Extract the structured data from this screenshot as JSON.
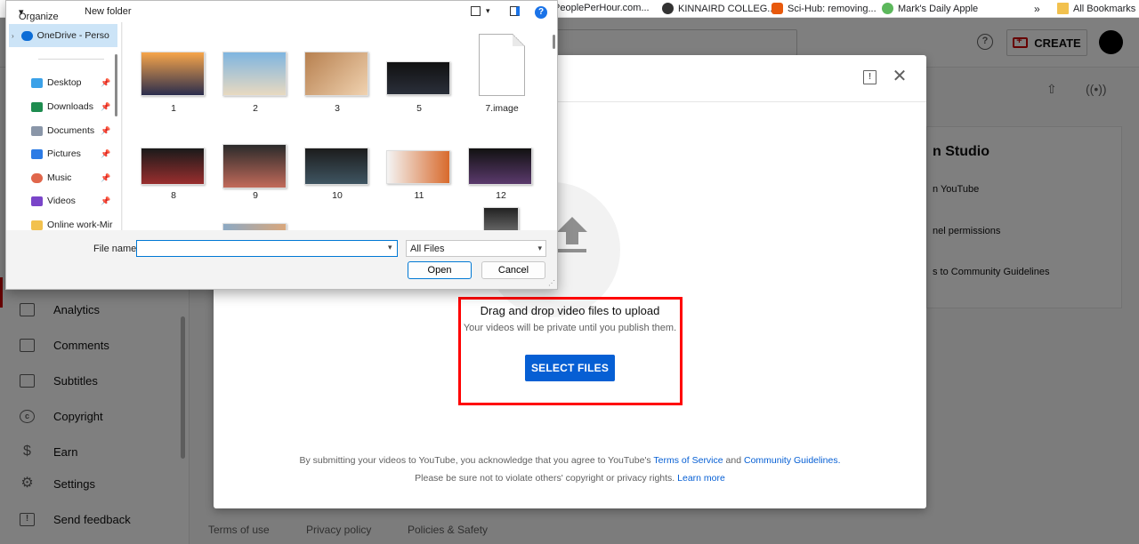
{
  "bookmarks": {
    "items": [
      "PeoplePerHour.com...",
      "KINNAIRD COLLEG...",
      "Sci-Hub: removing...",
      "Mark's Daily Apple"
    ],
    "overflow": "»",
    "all_label": "All Bookmarks"
  },
  "studio": {
    "create_label": "CREATE",
    "help_label": "?",
    "sidebar": {
      "items": [
        {
          "label": "Analytics",
          "icon": "analytics-icon"
        },
        {
          "label": "Comments",
          "icon": "comments-icon"
        },
        {
          "label": "Subtitles",
          "icon": "subtitles-icon"
        },
        {
          "label": "Copyright",
          "icon": "copyright-icon"
        },
        {
          "label": "Earn",
          "icon": "dollar-icon"
        },
        {
          "label": "Settings",
          "icon": "gear-icon"
        },
        {
          "label": "Send feedback",
          "icon": "feedback-icon"
        }
      ]
    },
    "footer": {
      "terms": "Terms of use",
      "privacy": "Privacy policy",
      "policies": "Policies & Safety"
    },
    "right_panel": {
      "title": "n Studio",
      "lines": [
        "n YouTube",
        "nel permissions",
        "s to Community Guidelines"
      ]
    }
  },
  "upload": {
    "drag_title": "Drag and drop video files to upload",
    "drag_sub": "Your videos will be private until you publish them.",
    "select_label": "SELECT FILES",
    "legal_1_pre": "By submitting your videos to YouTube, you acknowledge that you agree to YouTube's",
    "legal_terms": "Terms of Service",
    "legal_and": "and",
    "legal_guidelines": "Community Guidelines",
    "legal_period": ".",
    "legal_2_pre": "Please be sure not to violate others' copyright or privacy rights.",
    "learn_more": "Learn more",
    "highlight_color": "#ff0000",
    "accent": "#065fd4"
  },
  "dialog": {
    "toolbar": {
      "organize": "Organize",
      "new_folder": "New folder",
      "help": "?"
    },
    "nav": {
      "onedrive": "OneDrive - Perso",
      "items": [
        {
          "label": "Desktop",
          "color": "#3ba1e8"
        },
        {
          "label": "Downloads",
          "color": "#1e8c4f"
        },
        {
          "label": "Documents",
          "color": "#8a96a8"
        },
        {
          "label": "Pictures",
          "color": "#2c7be5"
        },
        {
          "label": "Music",
          "color": "#e0664b"
        },
        {
          "label": "Videos",
          "color": "#7a45c9"
        },
        {
          "label": "Online work-Mir",
          "color": "#f2c14e"
        }
      ]
    },
    "files": [
      {
        "label": "1",
        "colors": [
          "#f7a54a",
          "#2b2d4d"
        ]
      },
      {
        "label": "2",
        "colors": [
          "#7fb5e0",
          "#e8d9c0"
        ]
      },
      {
        "label": "3",
        "colors": [
          "#b7804f",
          "#f0d2b0"
        ]
      },
      {
        "label": "5",
        "colors": [
          "#111111",
          "#2a2f3a"
        ]
      },
      {
        "label": "7.image",
        "colors": [
          "#ffffff",
          "#ffffff"
        ]
      },
      {
        "label": "8",
        "colors": [
          "#1a1a1a",
          "#9a2e2e"
        ]
      },
      {
        "label": "9",
        "colors": [
          "#2b2b2b",
          "#c26a5a"
        ]
      },
      {
        "label": "10",
        "colors": [
          "#1c1c1c",
          "#3f5562"
        ]
      },
      {
        "label": "11",
        "colors": [
          "#f4f4f4",
          "#d86a2c"
        ]
      },
      {
        "label": "12",
        "colors": [
          "#111111",
          "#5b3a6d"
        ]
      }
    ],
    "file_name_label": "File name:",
    "file_name_value": "",
    "file_type": "All Files",
    "open_label": "Open",
    "cancel_label": "Cancel"
  }
}
